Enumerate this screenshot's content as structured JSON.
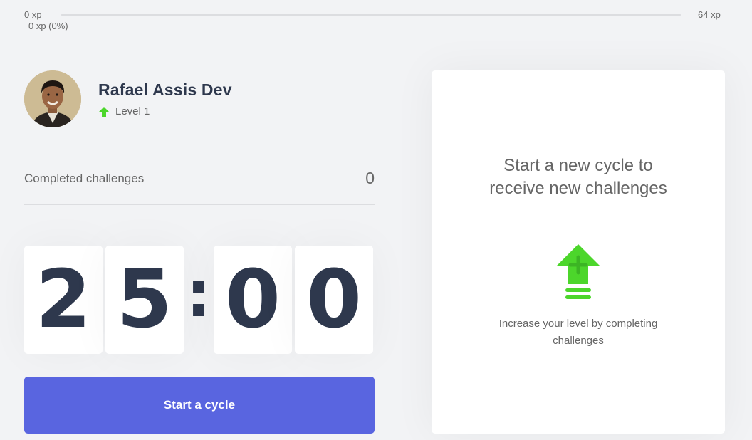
{
  "xp": {
    "min_label": "0 xp",
    "max_label": "64 xp",
    "current_label": "0 xp (0%)",
    "progress_percent": 0,
    "accent_color": "#4cd62b"
  },
  "profile": {
    "name": "Rafael Assis Dev",
    "level_label": "Level 1",
    "level_icon": "level-up-arrow-icon"
  },
  "completed": {
    "label": "Completed challenges",
    "count": "0"
  },
  "countdown": {
    "minute_left": "2",
    "minute_right": "5",
    "separator": ":",
    "second_left": "0",
    "second_right": "0"
  },
  "start_button": {
    "label": "Start a cycle",
    "color": "#5965e0"
  },
  "challenge_box": {
    "title_line1": "Start a new cycle to",
    "title_line2": "receive new challenges",
    "icon": "level-up-icon",
    "hint_line1": "Increase your level by completing",
    "hint_line2": "challenges"
  }
}
